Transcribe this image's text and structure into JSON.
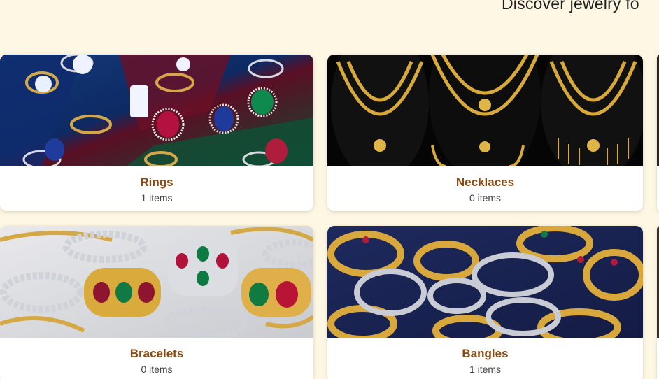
{
  "header": {
    "subtitle": "Discover jewelry fo"
  },
  "categories": [
    {
      "name": "Rings",
      "count": "1 items"
    },
    {
      "name": "Necklaces",
      "count": "0 items"
    },
    {
      "name": "Bracelets",
      "count": "0 items"
    },
    {
      "name": "Bangles",
      "count": "1 items"
    }
  ],
  "colors": {
    "background": "#fdf7e3",
    "card_title": "#8a4a12",
    "card_count": "#444444"
  }
}
